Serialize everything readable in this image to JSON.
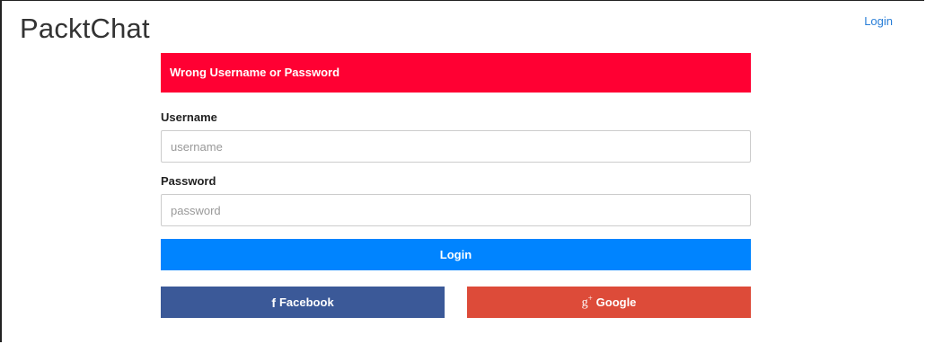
{
  "header": {
    "brand": "PacktChat",
    "nav_login_label": "Login"
  },
  "alert": {
    "message": "Wrong Username or Password"
  },
  "form": {
    "username_label": "Username",
    "username_placeholder": "username",
    "username_value": "",
    "password_label": "Password",
    "password_placeholder": "password",
    "password_value": "",
    "submit_label": "Login"
  },
  "social": {
    "facebook_label": "Facebook",
    "facebook_icon": "facebook-icon",
    "google_label": "Google",
    "google_icon": "google-plus-icon"
  },
  "colors": {
    "alert": "#ff0033",
    "primary": "#0084ff",
    "facebook": "#3b5998",
    "google": "#dd4b39",
    "link": "#2a7fd8"
  }
}
